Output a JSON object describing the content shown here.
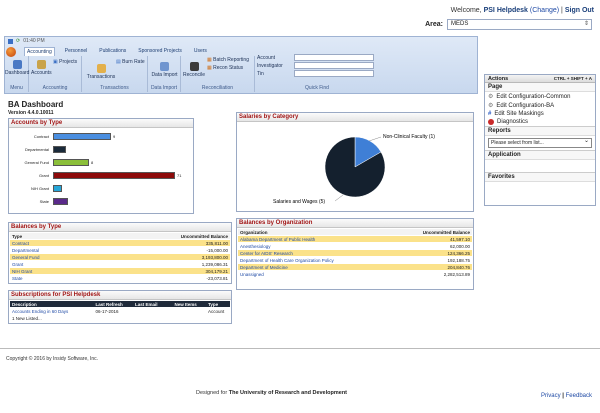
{
  "header": {
    "welcome_prefix": "Welcome,",
    "user": "PSI Helpdesk",
    "change": "(Change)",
    "sign_out": "Sign Out",
    "area_label": "Area:",
    "area_value": "MEDS"
  },
  "quick_access": {
    "time": "01:40 PM"
  },
  "ribbon": {
    "tabs": [
      "Accounting",
      "Personnel",
      "Publications",
      "Sponsored Projects",
      "Users"
    ],
    "active_tab": "Accounting",
    "groups": {
      "menu": "Menu",
      "accounting": "Accounting",
      "transactions": "Transactions",
      "data_import": "Data Import",
      "reconciliation": "Reconciliation",
      "quick_find": "Quick Find"
    },
    "buttons": {
      "dashboard": "Dashboard",
      "accounts": "Accounts",
      "projects": "Projects",
      "burn_rate": "Burn Rate",
      "transactions": "Transactions",
      "data_import": "Data Import",
      "reconcile": "Reconcile",
      "batch_reporting": "Batch Reporting",
      "recon_status": "Recon Status"
    },
    "fields": {
      "account": "Account",
      "investigator": "Investigator",
      "tin": "Tin"
    }
  },
  "dashboard": {
    "title": "BA Dashboard",
    "version": "Version 4.4.0.10011"
  },
  "accounts_by_type": {
    "title": "Accounts by Type",
    "items": [
      {
        "label": "Contract",
        "value": "9",
        "fraction": 0.45,
        "color": "#4a8ee0"
      },
      {
        "label": "Departmental",
        "value": "",
        "fraction": 0.1,
        "color": "#1a2a3a"
      },
      {
        "label": "General Fund",
        "value": "8",
        "fraction": 0.28,
        "color": "#8bbf3a"
      },
      {
        "label": "Grant",
        "value": "71",
        "fraction": 0.95,
        "color": "#8c0a0a"
      },
      {
        "label": "NIH Grant",
        "value": "",
        "fraction": 0.07,
        "color": "#26a6d8"
      },
      {
        "label": "State",
        "value": "",
        "fraction": 0.12,
        "color": "#5a2a8a"
      }
    ]
  },
  "balances_by_type": {
    "title": "Balances by Type",
    "col1": "Type",
    "col2": "Uncommitted Balance",
    "rows": [
      {
        "type": "Contract",
        "balance": "335,811.00"
      },
      {
        "type": "Departmental",
        "balance": "-15,000.00"
      },
      {
        "type": "General Fund",
        "balance": "3,193,800.00"
      },
      {
        "type": "Grant",
        "balance": "1,239,086.31"
      },
      {
        "type": "NIH Grant",
        "balance": "304,179.21"
      },
      {
        "type": "State",
        "balance": "-23,073.81"
      }
    ]
  },
  "subscriptions": {
    "title": "Subscriptions for PSI Helpdesk",
    "headers": [
      "Description",
      "Last Refresh",
      "Last Email",
      "New Items",
      "Type"
    ],
    "rows": [
      {
        "description": "Accounts Ending in 60 Days",
        "last_refresh": "06-17-2016",
        "last_email": "",
        "new_items": "",
        "type": "Account"
      }
    ],
    "more": "1 New Listed..."
  },
  "salaries_by_category": {
    "title": "Salaries by Category",
    "label_a": "Non-Clinical Faculty (1)",
    "label_b": "Salaries and Wages (5)"
  },
  "chart_data": {
    "type": "pie",
    "title": "Salaries by Category",
    "categories": [
      "Non-Clinical Faculty (1)",
      "Salaries and Wages (5)"
    ],
    "values": [
      1,
      5
    ],
    "colors": [
      "#3f7fd6",
      "#14202e"
    ]
  },
  "balances_by_org": {
    "title": "Balances by Organization",
    "col1": "Organization",
    "col2": "Uncommitted Balance",
    "rows": [
      {
        "org": "Alabama Department of Public Health",
        "balance": "41,597.10"
      },
      {
        "org": "Anesthesiology",
        "balance": "62,000.00"
      },
      {
        "org": "Center for AIDS' Research",
        "balance": "124,366.25"
      },
      {
        "org": "Department of Health Care Organization Policy",
        "balance": "192,188.75"
      },
      {
        "org": "Department of Medicine",
        "balance": "204,840.76"
      },
      {
        "org": "Unassigned",
        "balance": "2,282,513.89"
      }
    ]
  },
  "actions": {
    "title": "Actions",
    "shortcut": "CTRL + SHIFT + A",
    "page_label": "Page",
    "items": [
      {
        "label": "Edit Configuration-Common",
        "icon": "gear-icon"
      },
      {
        "label": "Edit Configuration-BA",
        "icon": "gear-icon"
      },
      {
        "label": "Edit Site Maskings",
        "icon": "hash-icon"
      },
      {
        "label": "Diagnostics",
        "icon": "diagnostics-icon"
      }
    ],
    "reports_label": "Reports",
    "reports_placeholder": "Please select from list...",
    "application_label": "Application",
    "favorites_label": "Favorites"
  },
  "footer": {
    "copyright": "Copyright © 2016 by Insidy Software, Inc.",
    "designed_prefix": "Designed for",
    "designed_org": "The University of Research and Development",
    "privacy": "Privacy",
    "separator": "|",
    "feedback": "Feedback"
  }
}
